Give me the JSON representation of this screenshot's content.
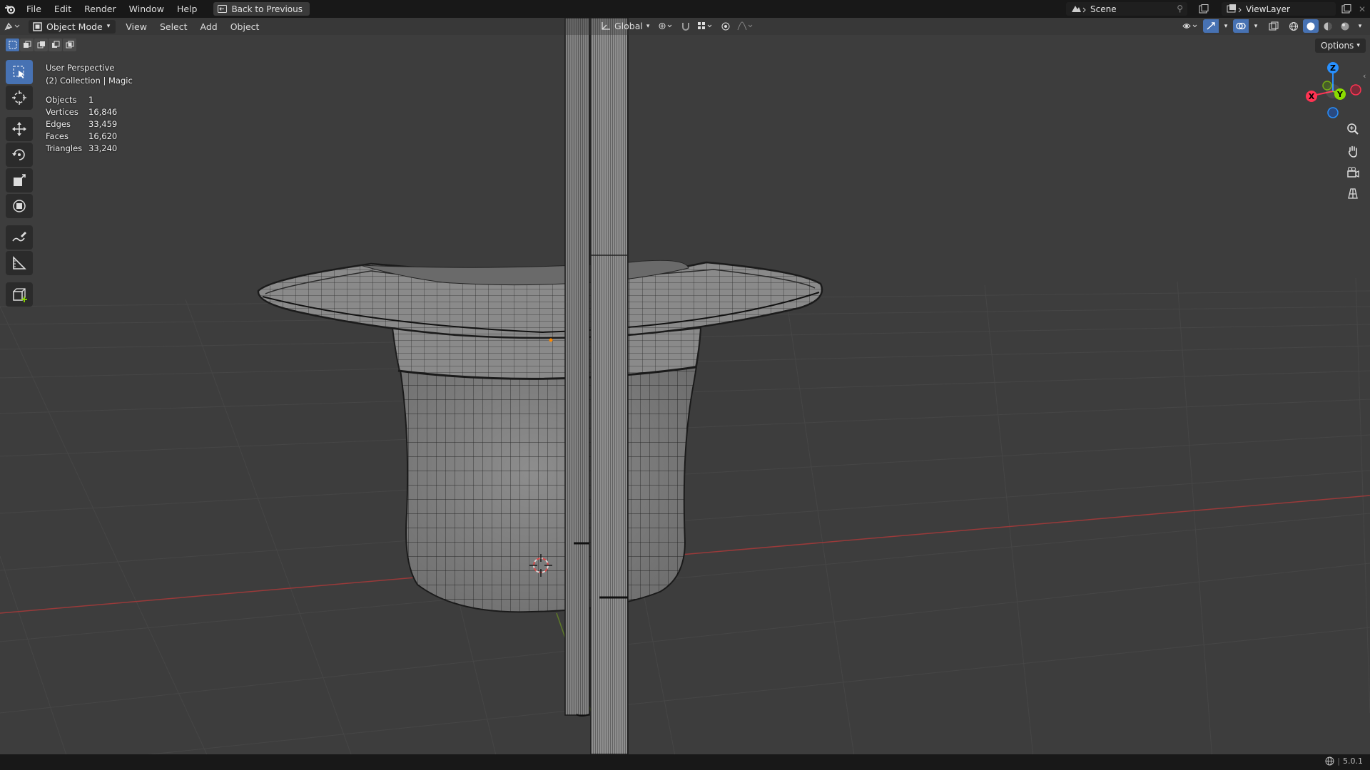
{
  "menu": {
    "items": [
      "File",
      "Edit",
      "Render",
      "Window",
      "Help"
    ],
    "back_label": "Back to Previous"
  },
  "top_right": {
    "scene": "Scene",
    "view_layer": "ViewLayer"
  },
  "viewport_header": {
    "mode": "Object Mode",
    "menus": [
      "View",
      "Select",
      "Add",
      "Object"
    ],
    "orientation": "Global"
  },
  "options_label": "Options",
  "overlay": {
    "perspective": "User Perspective",
    "collection": "(2) Collection | Magic",
    "stats": [
      {
        "label": "Objects",
        "value": "1"
      },
      {
        "label": "Vertices",
        "value": "16,846"
      },
      {
        "label": "Edges",
        "value": "33,459"
      },
      {
        "label": "Faces",
        "value": "16,620"
      },
      {
        "label": "Triangles",
        "value": "33,240"
      }
    ]
  },
  "gizmo": {
    "x": "X",
    "y": "Y",
    "z": "Z"
  },
  "status": {
    "version": "5.0.1"
  },
  "colors": {
    "accent": "#4772b3",
    "x_axis": "#ff3352",
    "y_axis": "#8bdc00",
    "z_axis": "#2890ff"
  }
}
